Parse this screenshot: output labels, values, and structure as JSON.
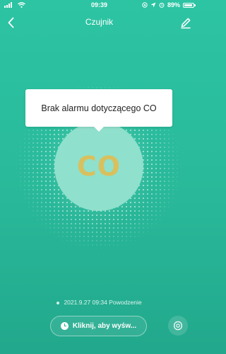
{
  "status_bar": {
    "time": "09:39",
    "battery": "89%",
    "battery_level": 0.89
  },
  "header": {
    "title": "Czujnik"
  },
  "tooltip": {
    "text": "Brak alarmu dotyczącego CO"
  },
  "sensor": {
    "label": "CO"
  },
  "last_event": {
    "text": "2021.9.27 09:34 Powodzenie"
  },
  "history_button": {
    "label": "Kliknij, aby wyśw..."
  },
  "colors": {
    "background": "#2cc4a3",
    "sensor_circle": "#8fe0cc",
    "sensor_label": "#d8c05e"
  },
  "icons": {
    "back": "chevron-left-icon",
    "edit": "pencil-icon",
    "history": "clock-icon",
    "settings": "gear-icon"
  }
}
